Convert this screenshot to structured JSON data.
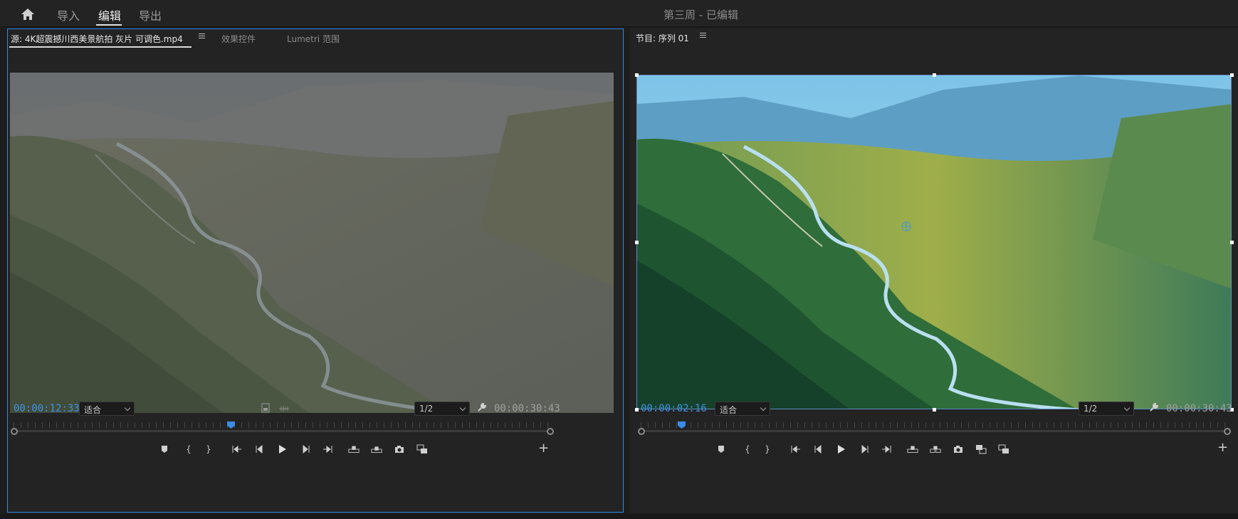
{
  "menu": {
    "home_icon": "home-icon",
    "items": [
      {
        "label": "导入",
        "active": false
      },
      {
        "label": "编辑",
        "active": true
      },
      {
        "label": "导出",
        "active": false
      }
    ],
    "project_title": "第三周 - 已编辑"
  },
  "source_panel": {
    "tabs": [
      {
        "label": "源: 4K超震撼川西美景航拍 灰片 可调色.mp4",
        "active": true
      },
      {
        "label": "效果控件",
        "active": false
      },
      {
        "label": "Lumetri 范围",
        "active": false
      }
    ],
    "timecode": "00:00:12:33",
    "fit_label": "适合",
    "resolution": "1/2",
    "duration": "00:00:30:43",
    "playhead_fraction": 0.404
  },
  "program_panel": {
    "tab_label": "节目: 序列 01",
    "timecode": "00:00:02:16",
    "fit_label": "适合",
    "resolution": "1/2",
    "duration": "00:00:30:43",
    "playhead_fraction": 0.069
  },
  "colors": {
    "accent": "#2d8ceb",
    "timecode": "#3f92e6",
    "panel_bg": "#232323"
  }
}
